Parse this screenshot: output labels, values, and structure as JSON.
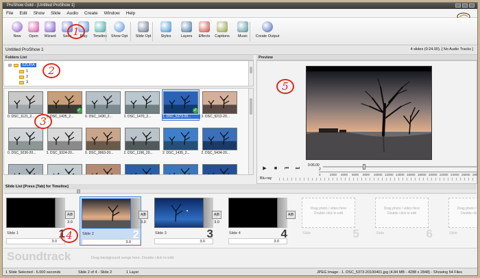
{
  "titlebar": {
    "title": "ProShow Gold - [Untitled ProShow 1]"
  },
  "menu": [
    "File",
    "Edit",
    "Show",
    "Slide",
    "Audio",
    "Create",
    "Window",
    "Help"
  ],
  "toolbar": [
    {
      "label": "New",
      "icon": "new-icon",
      "color": "#8a4fc6"
    },
    {
      "label": "Open",
      "icon": "open-icon",
      "color": "#d04a9a"
    },
    {
      "label": "Wizard",
      "icon": "wizard-icon",
      "color": "#7b4fc8"
    },
    {
      "label": "Save",
      "icon": "save-icon",
      "color": "#5d6fd0"
    },
    {
      "label": "Play",
      "icon": "play-icon",
      "color": "#4b87d4"
    },
    {
      "label": "Timeline",
      "icon": "timeline-icon",
      "color": "#37a6a0"
    },
    {
      "label": "Show Opt",
      "icon": "show-options-icon",
      "color": "#4d8ad6"
    },
    {
      "label": "Slide Opt",
      "icon": "slide-options-icon",
      "color": "#5b6b86"
    },
    {
      "label": "Styles",
      "icon": "styles-icon",
      "color": "#3b8fd0"
    },
    {
      "label": "Layers",
      "icon": "layers-icon",
      "color": "#3b6f9a"
    },
    {
      "label": "Effects",
      "icon": "effects-icon",
      "color": "#c8423a"
    },
    {
      "label": "Captions",
      "icon": "captions-icon",
      "color": "#8a9a3a"
    },
    {
      "label": "Music",
      "icon": "music-icon",
      "color": "#4a8a9a"
    },
    {
      "label": "Create Output",
      "icon": "create-output-icon",
      "color": "#3a5fb0"
    }
  ],
  "project": {
    "name": "Untitled ProShow 1",
    "summary": "4 slides (0:24.00), [ No Audio Tracks ]"
  },
  "folders": {
    "header": "Folders List",
    "root": "SZURA",
    "children": [
      "1",
      "2",
      "3"
    ]
  },
  "thumbnails": [
    {
      "caption": "0. DSC_1121_2...",
      "sky": "#c9c9c9",
      "ground": "#9fa7ad",
      "check": false
    },
    {
      "caption": "1. DSC_1425_2...",
      "sky": "#c79f7a",
      "ground": "#3e3a35",
      "check": true
    },
    {
      "caption": "0. DSC_1430_2...",
      "sky": "#b7c1c8",
      "ground": "#7a8c8f",
      "check": false
    },
    {
      "caption": "0. DSC_1470_2...",
      "sky": "#b9c7cf",
      "ground": "#6f7f82",
      "check": false
    },
    {
      "caption": "1. DSC_5373-20...",
      "sky": "#2a62b8",
      "ground": "#123a70",
      "check": true,
      "selected": true
    },
    {
      "caption": "0. DSC_9212-20...",
      "sky": "#d4b09a",
      "ground": "#5a4a45",
      "check": false
    },
    {
      "caption": "0. DSC_9230-20...",
      "sky": "#cfd4d6",
      "ground": "#8c9694",
      "check": false
    },
    {
      "caption": "0. DSC_9324-20...",
      "sky": "#d9d9d9",
      "ground": "#8a8a8a",
      "check": false
    },
    {
      "caption": "0. DSC_9963-20...",
      "sky": "#c9a58a",
      "ground": "#6a5a4a",
      "check": false
    },
    {
      "caption": "2. DSC_1196_20...",
      "sky": "#b9c3c9",
      "ground": "#505a5c",
      "check": false
    },
    {
      "caption": "2. DSC_1435_2...",
      "sky": "#3f7fc9",
      "ground": "#22507a",
      "check": false
    },
    {
      "caption": "2. DSC_5434-20...",
      "sky": "#3b6fb8",
      "ground": "#1a3a6a",
      "check": false
    },
    {
      "caption": "",
      "sky": "#a9b4bb",
      "ground": "#7d8a90",
      "check": false
    },
    {
      "caption": "",
      "sky": "#c2cbd0",
      "ground": "#8f9aa0",
      "check": false
    },
    {
      "caption": "",
      "sky": "#b58a72",
      "ground": "#5c4b40",
      "check": false
    },
    {
      "caption": "",
      "sky": "#2a5fa8",
      "ground": "#0f3a6c",
      "check": false
    },
    {
      "caption": "",
      "sky": "#3a75c0",
      "ground": "#1c4a80",
      "check": false
    },
    {
      "caption": "",
      "sky": "#244f96",
      "ground": "#0e2f5e",
      "check": false
    }
  ],
  "preview": {
    "header": "Preview",
    "time_current": "0:06.00",
    "time_slide": "2",
    "ruler": [
      "0",
      "2000",
      "4000",
      "6000",
      "8000",
      "10000",
      "12000",
      "14000",
      "16000",
      "18000",
      "20000",
      "22000",
      "24000",
      "26000",
      "28000"
    ],
    "format_label": "Blu-ray"
  },
  "slide_list": {
    "header": "Slide List [Press [Tab] for Timeline]",
    "slides": [
      {
        "label": "Slide 1",
        "number": "1",
        "duration": "3.0",
        "transition": "3.0",
        "kind": "black"
      },
      {
        "label": "Slide 2",
        "number": "2",
        "duration": "3.0",
        "transition": "3.0",
        "kind": "sunset",
        "selected": true
      },
      {
        "label": "Slide 3",
        "number": "3",
        "duration": "3.0",
        "transition": "3.0",
        "kind": "blue"
      },
      {
        "label": "Slide 4",
        "number": "4",
        "duration": "3.0",
        "transition": "",
        "kind": "black"
      }
    ],
    "empty_slides": [
      {
        "label": "Slide",
        "number": "5",
        "hint1": "Drag photo / video here",
        "hint2": "Double click to edit"
      },
      {
        "label": "Slide",
        "number": "6",
        "hint1": "Drag photo / video here",
        "hint2": "Double click to edit"
      },
      {
        "label": "Slide",
        "number": "7",
        "hint1": "Drag photo / video here",
        "hint2": "Double click to edit"
      }
    ]
  },
  "soundtrack": {
    "title": "Soundtrack",
    "hint": "Drag background songs here. Double click to edit."
  },
  "status": {
    "selection": "1 Slide Selected - 6.000 seconds",
    "position": "Slide 2 of 4 - Slide 2",
    "layers": "1 Layer",
    "file": "JPEG Image - 1. DSC_5373-20100401.jpg (4.84 MB - 4288 x 2848) - Showing 54 Files"
  },
  "annotations": [
    "1",
    "2",
    "3",
    "4",
    "5"
  ]
}
